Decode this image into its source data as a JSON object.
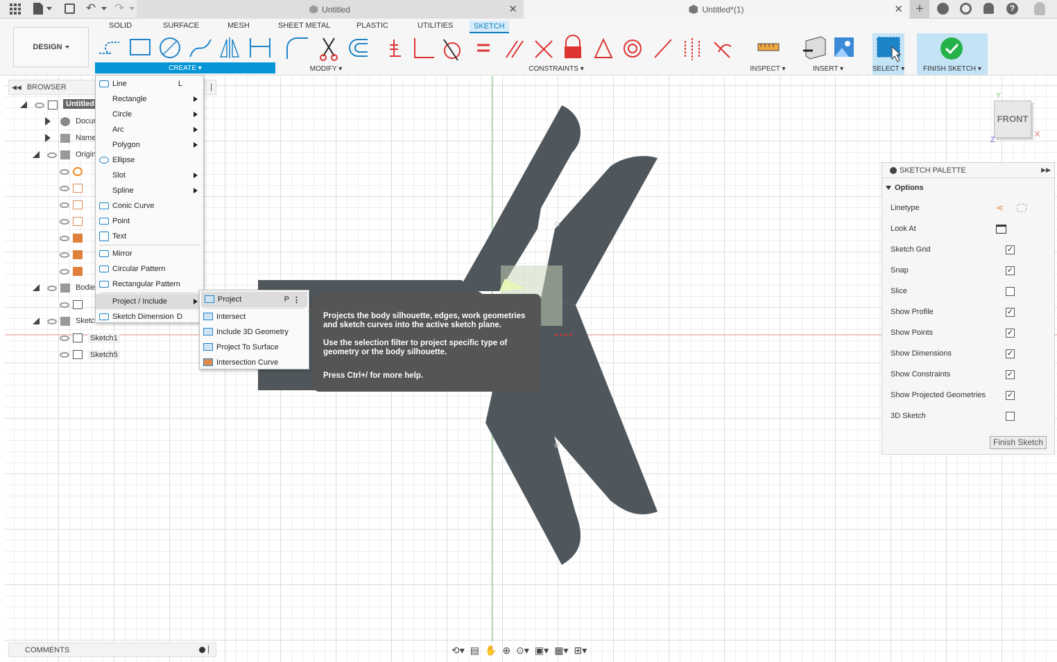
{
  "window": {
    "tab_left": "Untitled",
    "tab_right": "Untitled*(1)"
  },
  "workspace": {
    "mode": "DESIGN",
    "tabs": [
      "SOLID",
      "SURFACE",
      "MESH",
      "SHEET METAL",
      "PLASTIC",
      "UTILITIES",
      "SKETCH"
    ],
    "active_tab": "SKETCH"
  },
  "groups": {
    "create": "CREATE",
    "modify": "MODIFY",
    "constraints": "CONSTRAINTS",
    "inspect": "INSPECT",
    "insert": "INSERT",
    "select": "SELECT",
    "finish": "FINISH SKETCH"
  },
  "browser": {
    "title": "BROWSER",
    "items": [
      {
        "label": "Untitled"
      },
      {
        "label": "Document Settings"
      },
      {
        "label": "Named Views"
      },
      {
        "label": "Origin"
      },
      {
        "label": "Bodies"
      },
      {
        "label": "Sketches"
      },
      {
        "label": "Sketch1"
      },
      {
        "label": "Sketch5"
      }
    ]
  },
  "create_menu": {
    "items": [
      {
        "label": "Line",
        "shortcut": "L",
        "sub": false
      },
      {
        "label": "Rectangle",
        "shortcut": "",
        "sub": true
      },
      {
        "label": "Circle",
        "shortcut": "",
        "sub": true
      },
      {
        "label": "Arc",
        "shortcut": "",
        "sub": true
      },
      {
        "label": "Polygon",
        "shortcut": "",
        "sub": true
      },
      {
        "label": "Ellipse",
        "shortcut": "",
        "sub": false
      },
      {
        "label": "Slot",
        "shortcut": "",
        "sub": true
      },
      {
        "label": "Spline",
        "shortcut": "",
        "sub": true
      },
      {
        "label": "Conic Curve",
        "shortcut": "",
        "sub": false
      },
      {
        "label": "Point",
        "shortcut": "",
        "sub": false
      },
      {
        "label": "Text",
        "shortcut": "",
        "sub": false
      },
      {
        "label": "Mirror",
        "shortcut": "",
        "sub": false
      },
      {
        "label": "Circular Pattern",
        "shortcut": "",
        "sub": false
      },
      {
        "label": "Rectangular Pattern",
        "shortcut": "",
        "sub": false
      },
      {
        "label": "Project / Include",
        "shortcut": "",
        "sub": true
      },
      {
        "label": "Sketch Dimension",
        "shortcut": "D",
        "sub": false
      }
    ]
  },
  "project_menu": {
    "items": [
      {
        "label": "Project",
        "shortcut": "P"
      },
      {
        "label": "Intersect",
        "shortcut": ""
      },
      {
        "label": "Include 3D Geometry",
        "shortcut": ""
      },
      {
        "label": "Project To Surface",
        "shortcut": ""
      },
      {
        "label": "Intersection Curve",
        "shortcut": ""
      }
    ]
  },
  "tooltip": {
    "p1": "Projects the body silhouette, edges, work geometries and sketch curves into the active sketch plane.",
    "p2": "Use the selection filter to project specific type of geometry or the body silhouette.",
    "p3": "Press Ctrl+/ for more help."
  },
  "palette": {
    "title": "SKETCH PALETTE",
    "section": "Options",
    "rows": [
      {
        "label": "Linetype",
        "checked": null
      },
      {
        "label": "Look At",
        "checked": null
      },
      {
        "label": "Sketch Grid",
        "checked": true
      },
      {
        "label": "Snap",
        "checked": true
      },
      {
        "label": "Slice",
        "checked": false
      },
      {
        "label": "Show Profile",
        "checked": true
      },
      {
        "label": "Show Points",
        "checked": true
      },
      {
        "label": "Show Dimensions",
        "checked": true
      },
      {
        "label": "Show Constraints",
        "checked": true
      },
      {
        "label": "Show Projected Geometries",
        "checked": true
      },
      {
        "label": "3D Sketch",
        "checked": false
      }
    ],
    "finish_button": "Finish Sketch"
  },
  "viewcube": {
    "face": "FRONT",
    "x": "X",
    "y": "Y",
    "z": "Z"
  },
  "comments": {
    "label": "COMMENTS"
  },
  "colors": {
    "accent": "#0696d7",
    "body": "#4f575c",
    "finish_green": "#26b24b"
  }
}
